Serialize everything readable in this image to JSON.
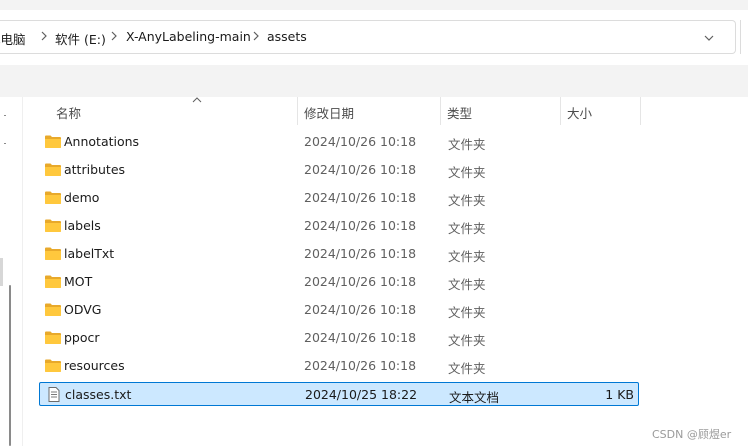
{
  "breadcrumb": {
    "items": [
      "此电脑",
      "软件 (E:)",
      "X-AnyLabeling-main",
      "assets"
    ]
  },
  "columns": {
    "name": "名称",
    "modified": "修改日期",
    "type": "类型",
    "size": "大小"
  },
  "files": [
    {
      "name": "Annotations",
      "modified": "2024/10/26 10:18",
      "type": "文件夹",
      "size": "",
      "icon": "folder-icon"
    },
    {
      "name": "attributes",
      "modified": "2024/10/26 10:18",
      "type": "文件夹",
      "size": "",
      "icon": "folder-icon"
    },
    {
      "name": "demo",
      "modified": "2024/10/26 10:18",
      "type": "文件夹",
      "size": "",
      "icon": "folder-icon"
    },
    {
      "name": "labels",
      "modified": "2024/10/26 10:18",
      "type": "文件夹",
      "size": "",
      "icon": "folder-icon"
    },
    {
      "name": "labelTxt",
      "modified": "2024/10/26 10:18",
      "type": "文件夹",
      "size": "",
      "icon": "folder-icon"
    },
    {
      "name": "MOT",
      "modified": "2024/10/26 10:18",
      "type": "文件夹",
      "size": "",
      "icon": "folder-icon"
    },
    {
      "name": "ODVG",
      "modified": "2024/10/26 10:18",
      "type": "文件夹",
      "size": "",
      "icon": "folder-icon"
    },
    {
      "name": "ppocr",
      "modified": "2024/10/26 10:18",
      "type": "文件夹",
      "size": "",
      "icon": "folder-icon"
    },
    {
      "name": "resources",
      "modified": "2024/10/26 10:18",
      "type": "文件夹",
      "size": "",
      "icon": "folder-icon"
    },
    {
      "name": "classes.txt",
      "modified": "2024/10/25 18:22",
      "type": "文本文档",
      "size": "1 KB",
      "icon": "text-file-icon",
      "selected": true
    }
  ],
  "watermark": "CSDN @顾煜er",
  "colors": {
    "selection_bg": "#cce8ff",
    "selection_border": "#0078d4",
    "folder_yellow": "#ffc83d"
  }
}
